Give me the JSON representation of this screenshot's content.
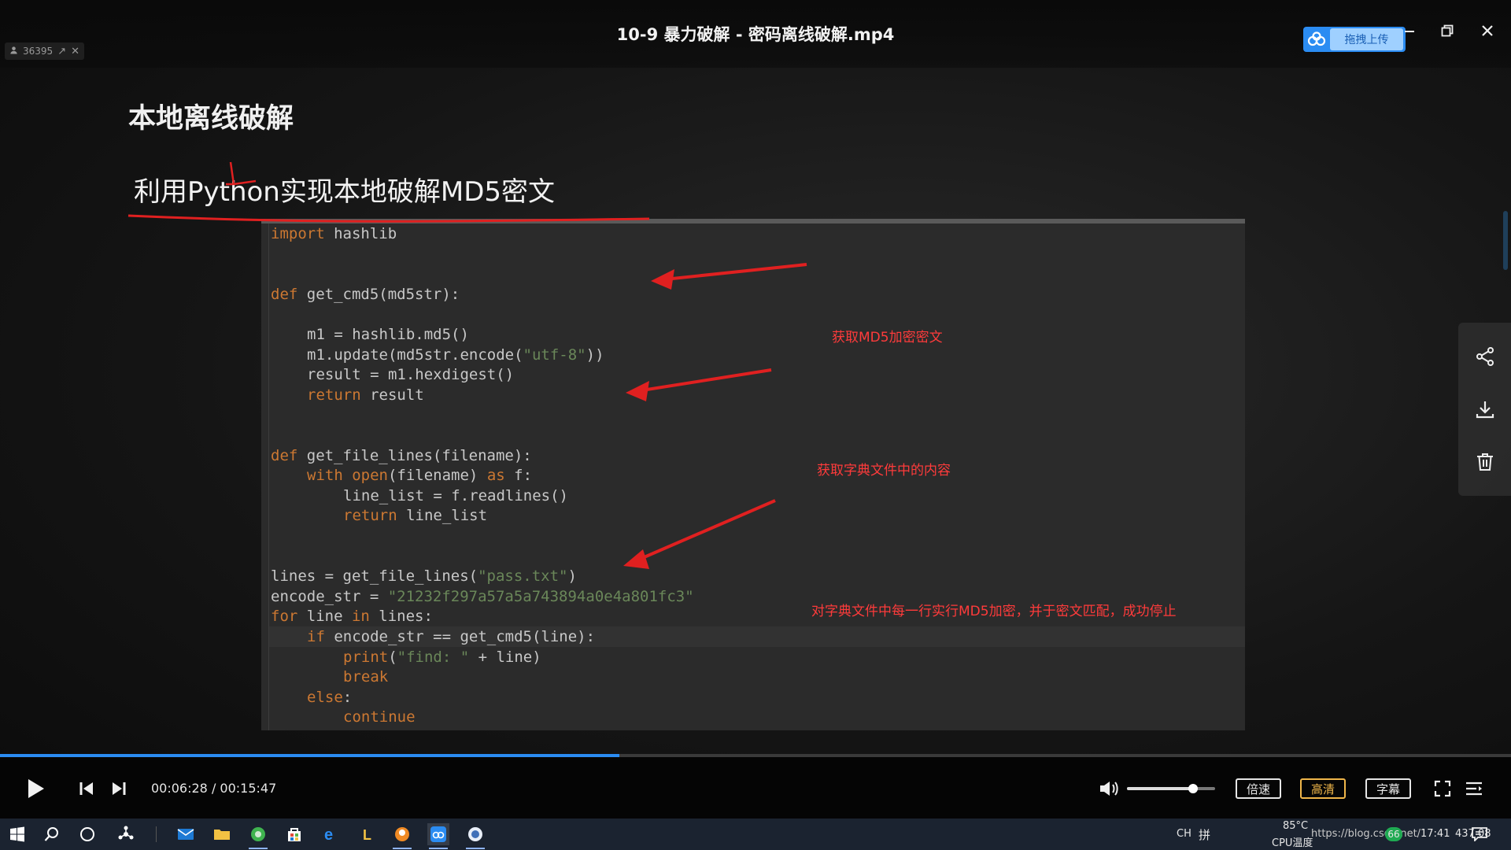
{
  "window": {
    "title": "10-9 暴力破解 - 密码离线破解.mp4",
    "viewer_count": "36395",
    "upload_label": "拖拽上传"
  },
  "slide": {
    "heading": "本地离线破解",
    "subtitle": "利用Python实现本地破解MD5密文",
    "code_lines": [
      {
        "indent": 0,
        "text": "import hashlib"
      },
      {
        "indent": 0,
        "text": ""
      },
      {
        "indent": 0,
        "text": ""
      },
      {
        "indent": 0,
        "text": "def get_cmd5(md5str):"
      },
      {
        "indent": 0,
        "text": ""
      },
      {
        "indent": 1,
        "text": "m1 = hashlib.md5()"
      },
      {
        "indent": 1,
        "text": "m1.update(md5str.encode(\"utf-8\"))"
      },
      {
        "indent": 1,
        "text": "result = m1.hexdigest()"
      },
      {
        "indent": 1,
        "text": "return result"
      },
      {
        "indent": 0,
        "text": ""
      },
      {
        "indent": 0,
        "text": ""
      },
      {
        "indent": 0,
        "text": "def get_file_lines(filename):"
      },
      {
        "indent": 1,
        "text": "with open(filename) as f:"
      },
      {
        "indent": 2,
        "text": "line_list = f.readlines()"
      },
      {
        "indent": 2,
        "text": "return line_list"
      },
      {
        "indent": 0,
        "text": ""
      },
      {
        "indent": 0,
        "text": ""
      },
      {
        "indent": 0,
        "text": "lines = get_file_lines(\"pass.txt\")"
      },
      {
        "indent": 0,
        "text": "encode_str = \"21232f297a57a5a743894a0e4a801fc3\""
      },
      {
        "indent": 0,
        "text": "for line in lines:"
      },
      {
        "indent": 1,
        "text": "if encode_str == get_cmd5(line):"
      },
      {
        "indent": 2,
        "text": "print(\"find: \" + line)"
      },
      {
        "indent": 2,
        "text": "break"
      },
      {
        "indent": 1,
        "text": "else:"
      },
      {
        "indent": 2,
        "text": "continue"
      }
    ],
    "annotations": [
      "获取MD5加密密文",
      "获取字典文件中的内容",
      "对字典文件中每一行实行MD5加密，并于密文匹配，成功停止"
    ]
  },
  "side_actions": [
    {
      "icon": "share-icon"
    },
    {
      "icon": "download-icon"
    },
    {
      "icon": "trash-icon"
    }
  ],
  "playback": {
    "current": "00:06:28",
    "total": "00:15:47",
    "time_text": "00:06:28 / 00:15:47",
    "progress_fraction": 0.41,
    "volume_fraction": 0.75,
    "speed_label": "倍速",
    "quality_label": "高清",
    "subtitle_label": "字幕",
    "accent_color": "#2b8cf2",
    "active_color": "#f0b64a"
  },
  "taskbar": {
    "apps": [
      "start-icon",
      "search-icon",
      "cortana-icon",
      "network-icon",
      "mail-icon",
      "file-explorer-icon",
      "browser-green-icon",
      "store-icon",
      "edge-icon",
      "app-l-icon",
      "app-orange-icon",
      "baidu-player-icon",
      "app-blue-icon"
    ],
    "ime": "CH",
    "ime_mode": "拼",
    "temperature": "85°C",
    "temperature_label": "CPU温度",
    "url_overlay": "https://blog.csdn.net/",
    "badge": "66",
    "clock": "17:41",
    "tail": "437 08"
  }
}
